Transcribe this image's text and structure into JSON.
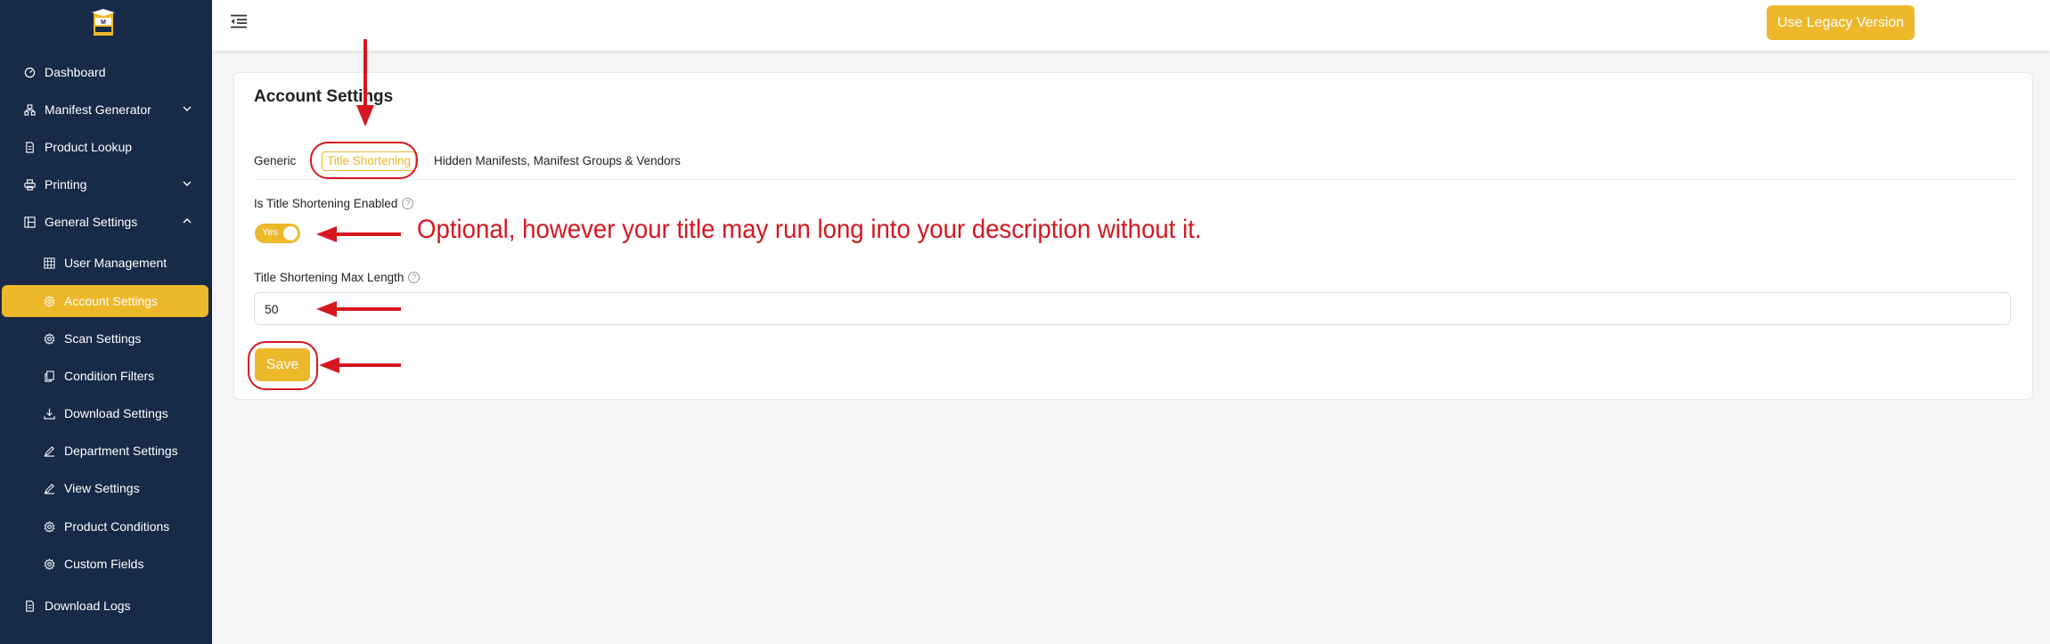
{
  "sidebar": {
    "items": [
      {
        "label": "Dashboard",
        "icon": "dashboard-icon"
      },
      {
        "label": "Manifest Generator",
        "icon": "manifest-icon"
      },
      {
        "label": "Product Lookup",
        "icon": "file-icon"
      },
      {
        "label": "Printing",
        "icon": "printer-icon"
      },
      {
        "label": "General Settings",
        "icon": "settings-grid-icon"
      },
      {
        "label": "User Management",
        "icon": "users-icon"
      },
      {
        "label": "Account Settings",
        "icon": "gear-icon"
      },
      {
        "label": "Scan Settings",
        "icon": "gear-icon"
      },
      {
        "label": "Condition Filters",
        "icon": "copy-icon"
      },
      {
        "label": "Download Settings",
        "icon": "download-icon"
      },
      {
        "label": "Department Settings",
        "icon": "edit-icon"
      },
      {
        "label": "View Settings",
        "icon": "edit-icon"
      },
      {
        "label": "Product Conditions",
        "icon": "gear-icon"
      },
      {
        "label": "Custom Fields",
        "icon": "gear-icon"
      },
      {
        "label": "Download Logs",
        "icon": "file-icon"
      }
    ]
  },
  "header": {
    "legacy_button": "Use Legacy Version"
  },
  "main": {
    "title": "Account Settings",
    "tabs": [
      {
        "label": "Generic",
        "active": false
      },
      {
        "label": "Title Shortening",
        "active": true
      },
      {
        "label": "Hidden Manifests, Manifest Groups & Vendors",
        "active": false
      }
    ],
    "shortening_enabled_label": "Is Title Shortening Enabled",
    "toggle_label": "Yes",
    "max_length_label": "Title Shortening Max Length",
    "max_length_value": "50",
    "save_label": "Save"
  },
  "annotation": {
    "text": "Optional, however your title may run long into your description without it.",
    "color": "#d6171f"
  },
  "colors": {
    "sidebar_bg": "#172a47",
    "accent": "#eeb82b"
  }
}
